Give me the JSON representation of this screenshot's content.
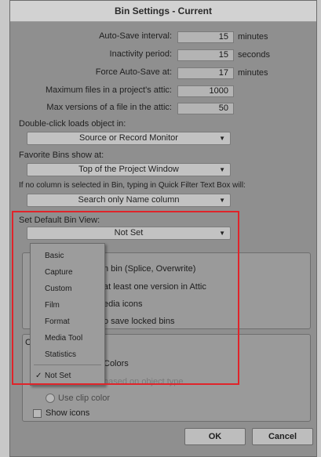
{
  "window": {
    "title": "Bin Settings - Current"
  },
  "settings": [
    {
      "label": "Auto-Save interval:",
      "value": "15",
      "unit": "minutes"
    },
    {
      "label": "Inactivity period:",
      "value": "15",
      "unit": "seconds"
    },
    {
      "label": "Force Auto-Save at:",
      "value": "17",
      "unit": "minutes"
    },
    {
      "label": "Maximum files in a project's attic:",
      "value": "1000",
      "unit": ""
    },
    {
      "label": "Max versions of a file in the attic:",
      "value": "50",
      "unit": ""
    }
  ],
  "double_click": {
    "label": "Double-click loads object in:",
    "value": "Source or Record Monitor"
  },
  "favorite_bins": {
    "label": "Favorite Bins show at:",
    "value": "Top of the Project Window"
  },
  "quick_filter": {
    "label": "If no column is selected in Bin, typing in Quick Filter Text Box will:",
    "value": "Search only Name column"
  },
  "default_view": {
    "label": "Set Default Bin View:",
    "value": "Not Set"
  },
  "options": {
    "option1": "n bin (Splice, Overwrite)",
    "option2": "at least one version in Attic",
    "option3": "edia icons",
    "option4": "o save locked bins",
    "colors": "Colors",
    "based_on_type": "based on object type",
    "clip_color": "Use clip color",
    "show_icons": "Show icons",
    "group_initial": "C"
  },
  "menu": {
    "items": [
      "Basic",
      "Capture",
      "Custom",
      "Film",
      "Format",
      "Media Tool",
      "Statistics"
    ],
    "selected": "Not Set",
    "check": "✓"
  },
  "buttons": {
    "ok": "OK",
    "cancel": "Cancel"
  }
}
